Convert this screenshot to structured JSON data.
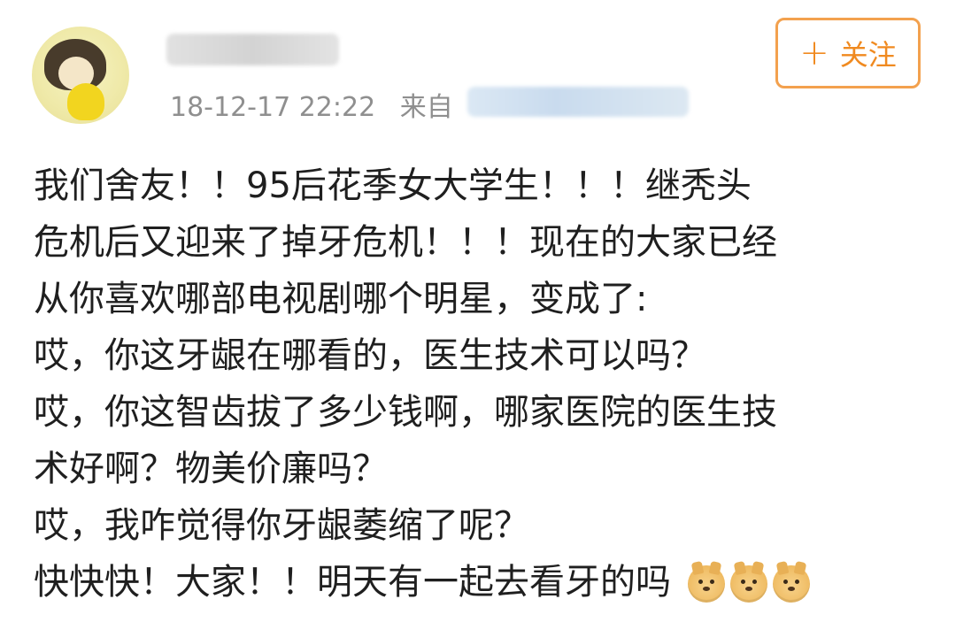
{
  "post": {
    "author": {
      "name_hidden": true
    },
    "timestamp": "18-12-17 22:22",
    "source_prefix": "来自",
    "follow_button": {
      "label": "关注",
      "icon": "plus-icon"
    },
    "lines": [
      "我们舍友！！95后花季女大学生！！！继秃头",
      "危机后又迎来了掉牙危机！！！现在的大家已经",
      "从你喜欢哪部电视剧哪个明星，变成了:",
      "哎，你这牙龈在哪看的，医生技术可以吗？",
      "哎，你这智齿拔了多少钱啊，哪家医院的医生技",
      "术好啊？物美价廉吗？",
      "哎，我咋觉得你牙龈萎缩了呢？",
      "快快快！大家！！明天有一起去看牙的吗"
    ],
    "emojis": [
      "doge-icon",
      "doge-icon",
      "doge-icon"
    ]
  }
}
